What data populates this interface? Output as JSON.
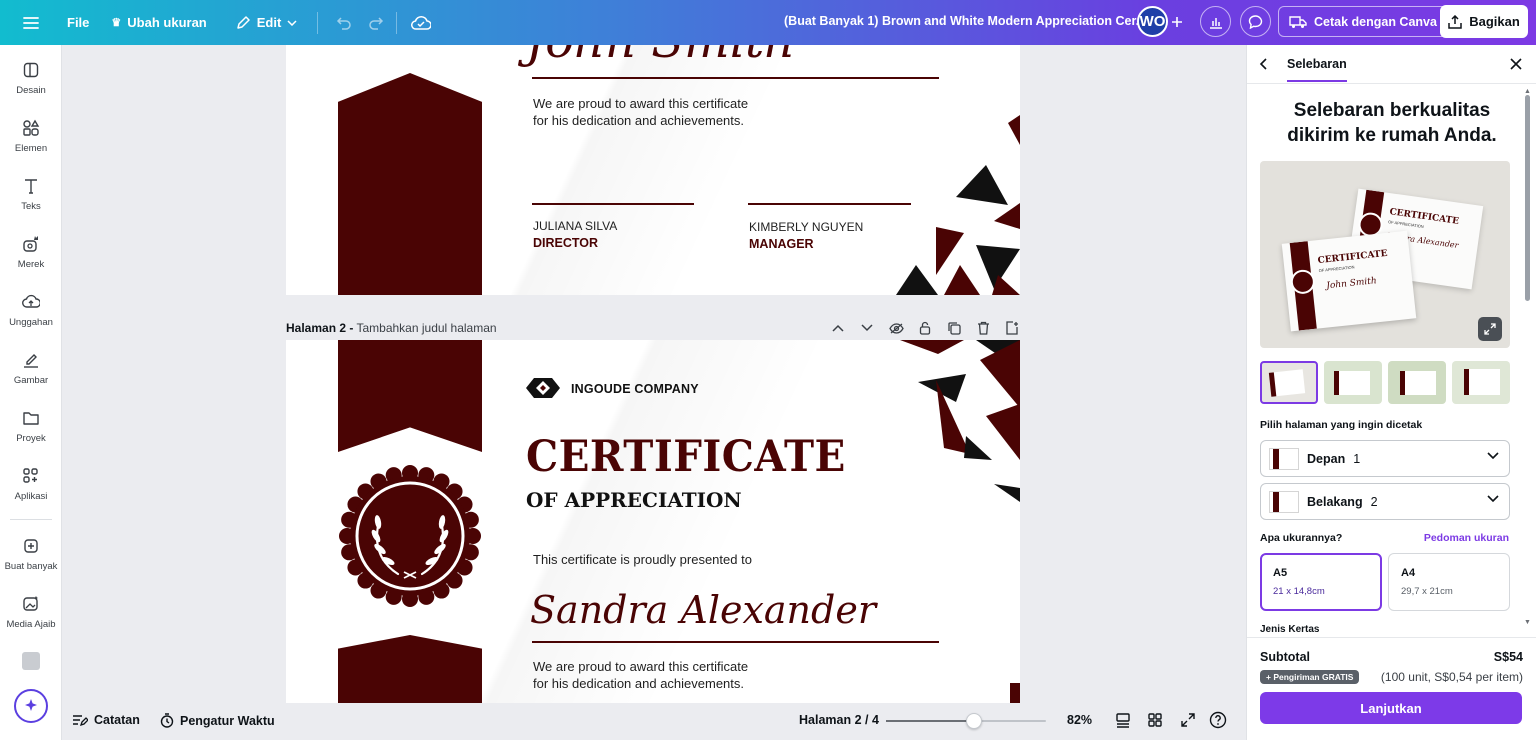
{
  "topbar": {
    "file_label": "File",
    "resize_label": "Ubah ukuran",
    "edit_label": "Edit",
    "doc_title": "(Buat Banyak 1) Brown and White Modern Appreciation Cer...",
    "avatar_initials": "WO",
    "print_label": "Cetak dengan Canva",
    "share_label": "Bagikan"
  },
  "sidebar": {
    "items": [
      {
        "label": "Desain",
        "icon": "layout-icon"
      },
      {
        "label": "Elemen",
        "icon": "shapes-icon"
      },
      {
        "label": "Teks",
        "icon": "text-icon"
      },
      {
        "label": "Merek",
        "icon": "brand-icon"
      },
      {
        "label": "Unggahan",
        "icon": "upload-icon"
      },
      {
        "label": "Gambar",
        "icon": "draw-icon"
      },
      {
        "label": "Proyek",
        "icon": "folder-icon"
      },
      {
        "label": "Aplikasi",
        "icon": "apps-icon"
      },
      {
        "label": "Buat banyak",
        "icon": "bulk-create-icon"
      },
      {
        "label": "Media Ajaib",
        "icon": "magic-media-icon"
      }
    ]
  },
  "page1": {
    "name": "John Smith",
    "body_line1": "We are proud to award this certificate",
    "body_line2": "for his dedication and achievements.",
    "sig1_name": "JULIANA SILVA",
    "sig1_role": "DIRECTOR",
    "sig2_name": "KIMBERLY NGUYEN",
    "sig2_role": "MANAGER"
  },
  "page2_header": {
    "label": "Halaman 2 -",
    "placeholder": "Tambahkan judul halaman"
  },
  "page2": {
    "company": "INGOUDE COMPANY",
    "title": "CERTIFICATE",
    "subtitle": "OF APPRECIATION",
    "presented": "This certificate is proudly presented to",
    "name": "Sandra Alexander",
    "body_line1": "We are proud to award this certificate",
    "body_line2": "for his dedication and achievements."
  },
  "bottombar": {
    "notes_label": "Catatan",
    "timer_label": "Pengatur Waktu",
    "page_indicator": "Halaman 2 / 4",
    "zoom_level": "82%",
    "zoom_fraction": 0.55
  },
  "panel": {
    "tab_label": "Selebaran",
    "headline": "Selebaran berkualitas dikirim ke rumah Anda.",
    "preview_cert1_title": "CERTIFICATE",
    "preview_cert1_sub": "OF APPRECIATION",
    "preview_cert1_name": "John Smith",
    "preview_cert2_title": "CERTIFICATE",
    "preview_cert2_sub": "OF APPRECIATION",
    "preview_cert2_name": "Sandra Alexander",
    "pick_pages_label": "Pilih halaman yang ingin dicetak",
    "front_label": "Depan",
    "front_page": "1",
    "back_label": "Belakang",
    "back_page": "2",
    "size_question": "Apa ukurannya?",
    "size_guide": "Pedoman ukuran",
    "sizes": [
      {
        "name": "A5",
        "dims": "21 x 14,8cm"
      },
      {
        "name": "A4",
        "dims": "29,7 x 21cm"
      }
    ],
    "paper_type_label": "Jenis Kertas",
    "subtotal_label": "Subtotal",
    "subtotal_value": "S$54",
    "shipping_badge": "+ Pengiriman GRATIS",
    "unit_info": "(100 unit, S$0,54 per item)",
    "continue_label": "Lanjutkan"
  },
  "colors": {
    "maroon": "#4a0404",
    "accent": "#7c3ae4"
  }
}
